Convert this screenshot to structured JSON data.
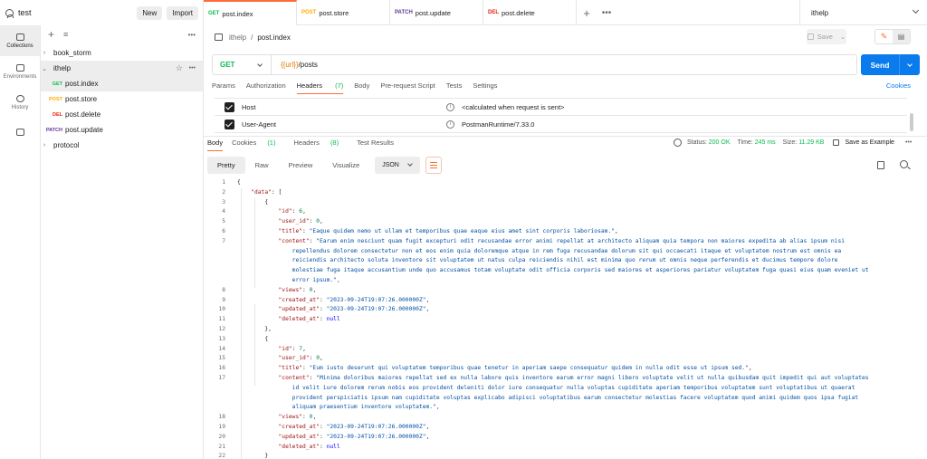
{
  "workspace": {
    "name": "test",
    "new_label": "New",
    "import_label": "Import"
  },
  "tabs": [
    {
      "method": "GET",
      "name": "post.index",
      "active": true
    },
    {
      "method": "POST",
      "name": "post.store"
    },
    {
      "method": "PATCH",
      "name": "post.update"
    },
    {
      "method": "DEL",
      "name": "post.delete"
    }
  ],
  "environment": "ithelp",
  "rail": [
    {
      "label": "Collections",
      "icon": "collections-icon"
    },
    {
      "label": "Environments",
      "icon": "environments-icon"
    },
    {
      "label": "History",
      "icon": "history-icon"
    },
    {
      "label": "",
      "icon": "apps-icon"
    }
  ],
  "sidebar": {
    "items": [
      {
        "label": "book_storm"
      },
      {
        "label": "ithelp"
      },
      {
        "method": "GET",
        "label": "post.index"
      },
      {
        "method": "POST",
        "label": "post.store"
      },
      {
        "method": "DEL",
        "label": "post.delete"
      },
      {
        "method": "PATCH",
        "label": "post.update"
      },
      {
        "label": "protocol"
      }
    ]
  },
  "request": {
    "breadcrumb_parent": "ithelp",
    "breadcrumb_sep": "/",
    "breadcrumb_current": "post.index",
    "save_label": "Save",
    "method": "GET",
    "url_var": "{{url}}",
    "url_path": "/posts",
    "send_label": "Send",
    "tabs": [
      "Params",
      "Authorization",
      "Headers",
      "Body",
      "Pre-request Script",
      "Tests",
      "Settings"
    ],
    "headers_count": "(7)",
    "cookies_label": "Cookies",
    "headers": [
      {
        "key": "Host",
        "value": "<calculated when request is sent>"
      },
      {
        "key": "User-Agent",
        "value": "PostmanRuntime/7.33.0"
      }
    ]
  },
  "response": {
    "tabs": [
      "Body",
      "Cookies",
      "Headers",
      "Test Results"
    ],
    "cookies_count": "(1)",
    "headers_count": "(8)",
    "status_label": "Status:",
    "status": "200 OK",
    "time_label": "Time:",
    "time": "245 ms",
    "size_label": "Size:",
    "size": "11.29 KB",
    "save_example_label": "Save as Example",
    "formats": [
      "Pretty",
      "Raw",
      "Preview",
      "Visualize"
    ],
    "lang": "JSON"
  },
  "code_lines": [
    {
      "n": "1",
      "t": "{"
    },
    {
      "n": "2",
      "t": "    \"data\": ["
    },
    {
      "n": "3",
      "t": "        {"
    },
    {
      "n": "4",
      "t": "            \"id\": 6,"
    },
    {
      "n": "5",
      "t": "            \"user_id\": 0,"
    },
    {
      "n": "6",
      "t": "            \"title\": \"Eaque quidem nemo ut ullam et temporibus quae eaque eius amet sint corporis laboriosam.\","
    },
    {
      "n": "7",
      "t": "            \"content\": \"Earum enim nesciunt quam fugit excepturi odit recusandae error animi repellat at architecto aliquam quia tempora non maiores expedita ab alias ipsum nisi"
    },
    {
      "n": "",
      "t": "                repellendus dolorem consectetur non et eos enim quia doloremque atque in rem fuga recusandae dolorum sit qui occaecati itaque et voluptatem nostrum est omnis ea"
    },
    {
      "n": "",
      "t": "                reiciendis architecto soluta inventore sit voluptatem ut natus culpa reiciendis nihil est minima quo rerum ut omnis neque perferendis et ducimus tempore dolore"
    },
    {
      "n": "",
      "t": "                molestiae fuga itaque accusantium unde quo accusamus totam voluptate odit officia corporis sed maiores et asperiores pariatur voluptatem fuga quasi eius quam eveniet ut"
    },
    {
      "n": "",
      "t": "                error ipsum.\","
    },
    {
      "n": "8",
      "t": "            \"views\": 0,"
    },
    {
      "n": "9",
      "t": "            \"created_at\": \"2023-09-24T19:07:26.000000Z\","
    },
    {
      "n": "10",
      "t": "            \"updated_at\": \"2023-09-24T19:07:26.000000Z\","
    },
    {
      "n": "11",
      "t": "            \"deleted_at\": null"
    },
    {
      "n": "12",
      "t": "        },"
    },
    {
      "n": "13",
      "t": "        {"
    },
    {
      "n": "14",
      "t": "            \"id\": 7,"
    },
    {
      "n": "15",
      "t": "            \"user_id\": 0,"
    },
    {
      "n": "16",
      "t": "            \"title\": \"Eum iusto deserunt qui voluptatem temporibus quae tenetur in aperiam saepe consequatur quidem in nulla odit esse ut ipsum sed.\","
    },
    {
      "n": "17",
      "t": "            \"content\": \"Minima doloribus maiores repellat sed ex nulla labore quis inventore earum error magni libero voluptate velit ut nulla quibusdam quit impedit qui aut voluptates"
    },
    {
      "n": "",
      "t": "                id velit iure dolorem rerum nobis eos provident deleniti dolor iure consequatur nulla voluptas cupiditate aperiam temporibus voluptatem sunt voluptatibus ut quaerat"
    },
    {
      "n": "",
      "t": "                provident perspiciatis ipsum nam cupiditate voluptas explicabo adipisci voluptatibus earum consectetur molestias facere voluptatem quod animi quidem quos ipsa fugiat"
    },
    {
      "n": "",
      "t": "                aliquam praesentium inventore voluptatem.\","
    },
    {
      "n": "18",
      "t": "            \"views\": 0,"
    },
    {
      "n": "19",
      "t": "            \"created_at\": \"2023-09-24T19:07:26.000000Z\","
    },
    {
      "n": "20",
      "t": "            \"updated_at\": \"2023-09-24T19:07:26.000000Z\","
    },
    {
      "n": "21",
      "t": "            \"deleted_at\": null"
    },
    {
      "n": "22",
      "t": "        }"
    }
  ]
}
